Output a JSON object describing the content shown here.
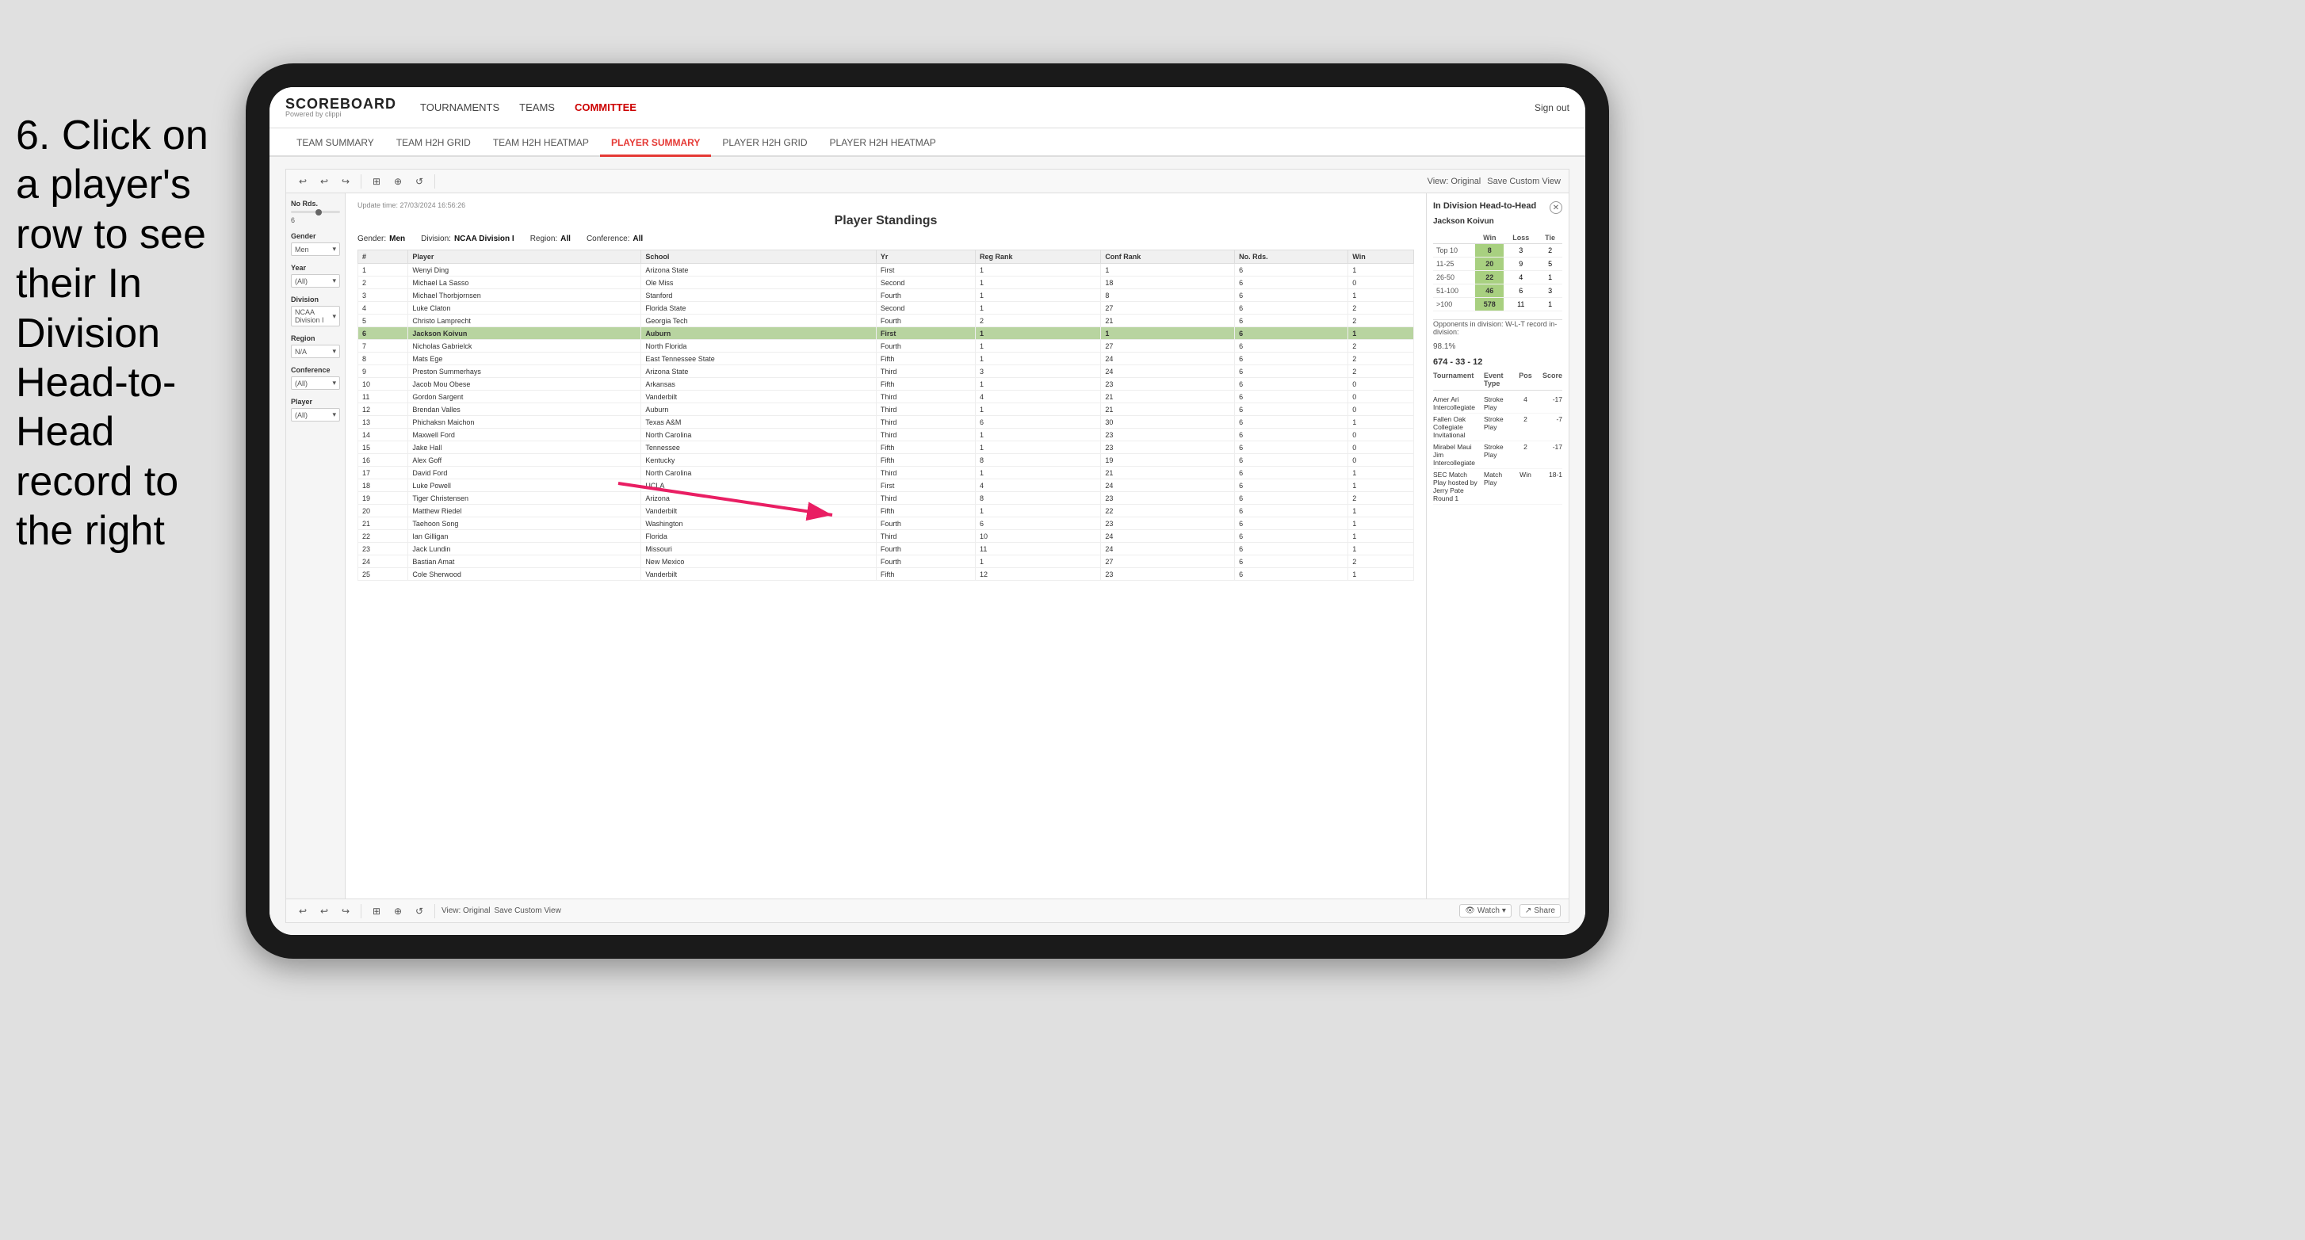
{
  "instruction": {
    "text": "6. Click on a player's row to see their In Division Head-to-Head record to the right"
  },
  "nav": {
    "logo": "SCOREBOARD",
    "powered": "Powered by clippi",
    "items": [
      "TOURNAMENTS",
      "TEAMS",
      "COMMITTEE"
    ],
    "sign_out": "Sign out"
  },
  "sub_nav": {
    "items": [
      "TEAM SUMMARY",
      "TEAM H2H GRID",
      "TEAM H2H HEATMAP",
      "PLAYER SUMMARY",
      "PLAYER H2H GRID",
      "PLAYER H2H HEATMAP"
    ],
    "active": "PLAYER SUMMARY"
  },
  "report": {
    "update_time_label": "Update time:",
    "update_time_value": "27/03/2024 16:56:26",
    "title": "Player Standings",
    "filters": {
      "gender_label": "Gender:",
      "gender_value": "Men",
      "division_label": "Division:",
      "division_value": "NCAA Division I",
      "region_label": "Region:",
      "region_value": "All",
      "conference_label": "Conference:",
      "conference_value": "All"
    }
  },
  "left_filters": {
    "no_rds": {
      "label": "No Rds.",
      "value": "6"
    },
    "gender": {
      "label": "Gender",
      "value": "Men"
    },
    "year": {
      "label": "Year",
      "value": "(All)"
    },
    "division": {
      "label": "Division",
      "value": "NCAA Division I"
    },
    "region": {
      "label": "Region",
      "value": "N/A"
    },
    "conference": {
      "label": "Conference",
      "value": "(All)"
    },
    "player": {
      "label": "Player",
      "value": "(All)"
    }
  },
  "table": {
    "headers": [
      "#",
      "Player",
      "School",
      "Yr",
      "Reg Rank",
      "Conf Rank",
      "No. Rds.",
      "Win"
    ],
    "rows": [
      {
        "rank": "1",
        "player": "Wenyi Ding",
        "school": "Arizona State",
        "yr": "First",
        "reg_rank": "1",
        "conf_rank": "1",
        "no_rds": "6",
        "win": "1",
        "highlighted": false
      },
      {
        "rank": "2",
        "player": "Michael La Sasso",
        "school": "Ole Miss",
        "yr": "Second",
        "reg_rank": "1",
        "conf_rank": "18",
        "no_rds": "6",
        "win": "0",
        "highlighted": false
      },
      {
        "rank": "3",
        "player": "Michael Thorbjornsen",
        "school": "Stanford",
        "yr": "Fourth",
        "reg_rank": "1",
        "conf_rank": "8",
        "no_rds": "6",
        "win": "1",
        "highlighted": false
      },
      {
        "rank": "4",
        "player": "Luke Claton",
        "school": "Florida State",
        "yr": "Second",
        "reg_rank": "1",
        "conf_rank": "27",
        "no_rds": "6",
        "win": "2",
        "highlighted": false
      },
      {
        "rank": "5",
        "player": "Christo Lamprecht",
        "school": "Georgia Tech",
        "yr": "Fourth",
        "reg_rank": "2",
        "conf_rank": "21",
        "no_rds": "6",
        "win": "2",
        "highlighted": false
      },
      {
        "rank": "6",
        "player": "Jackson Koivun",
        "school": "Auburn",
        "yr": "First",
        "reg_rank": "1",
        "conf_rank": "1",
        "no_rds": "6",
        "win": "1",
        "highlighted": true
      },
      {
        "rank": "7",
        "player": "Nicholas Gabrielck",
        "school": "North Florida",
        "yr": "Fourth",
        "reg_rank": "1",
        "conf_rank": "27",
        "no_rds": "6",
        "win": "2",
        "highlighted": false
      },
      {
        "rank": "8",
        "player": "Mats Ege",
        "school": "East Tennessee State",
        "yr": "Fifth",
        "reg_rank": "1",
        "conf_rank": "24",
        "no_rds": "6",
        "win": "2",
        "highlighted": false
      },
      {
        "rank": "9",
        "player": "Preston Summerhays",
        "school": "Arizona State",
        "yr": "Third",
        "reg_rank": "3",
        "conf_rank": "24",
        "no_rds": "6",
        "win": "2",
        "highlighted": false
      },
      {
        "rank": "10",
        "player": "Jacob Mou Obese",
        "school": "Arkansas",
        "yr": "Fifth",
        "reg_rank": "1",
        "conf_rank": "23",
        "no_rds": "6",
        "win": "0",
        "highlighted": false
      },
      {
        "rank": "11",
        "player": "Gordon Sargent",
        "school": "Vanderbilt",
        "yr": "Third",
        "reg_rank": "4",
        "conf_rank": "21",
        "no_rds": "6",
        "win": "0",
        "highlighted": false
      },
      {
        "rank": "12",
        "player": "Brendan Valles",
        "school": "Auburn",
        "yr": "Third",
        "reg_rank": "1",
        "conf_rank": "21",
        "no_rds": "6",
        "win": "0",
        "highlighted": false
      },
      {
        "rank": "13",
        "player": "Phichaksn Maichon",
        "school": "Texas A&M",
        "yr": "Third",
        "reg_rank": "6",
        "conf_rank": "30",
        "no_rds": "6",
        "win": "1",
        "highlighted": false
      },
      {
        "rank": "14",
        "player": "Maxwell Ford",
        "school": "North Carolina",
        "yr": "Third",
        "reg_rank": "1",
        "conf_rank": "23",
        "no_rds": "6",
        "win": "0",
        "highlighted": false
      },
      {
        "rank": "15",
        "player": "Jake Hall",
        "school": "Tennessee",
        "yr": "Fifth",
        "reg_rank": "1",
        "conf_rank": "23",
        "no_rds": "6",
        "win": "0",
        "highlighted": false
      },
      {
        "rank": "16",
        "player": "Alex Goff",
        "school": "Kentucky",
        "yr": "Fifth",
        "reg_rank": "8",
        "conf_rank": "19",
        "no_rds": "6",
        "win": "0",
        "highlighted": false
      },
      {
        "rank": "17",
        "player": "David Ford",
        "school": "North Carolina",
        "yr": "Third",
        "reg_rank": "1",
        "conf_rank": "21",
        "no_rds": "6",
        "win": "1",
        "highlighted": false
      },
      {
        "rank": "18",
        "player": "Luke Powell",
        "school": "UCLA",
        "yr": "First",
        "reg_rank": "4",
        "conf_rank": "24",
        "no_rds": "6",
        "win": "1",
        "highlighted": false
      },
      {
        "rank": "19",
        "player": "Tiger Christensen",
        "school": "Arizona",
        "yr": "Third",
        "reg_rank": "8",
        "conf_rank": "23",
        "no_rds": "6",
        "win": "2",
        "highlighted": false
      },
      {
        "rank": "20",
        "player": "Matthew Riedel",
        "school": "Vanderbilt",
        "yr": "Fifth",
        "reg_rank": "1",
        "conf_rank": "22",
        "no_rds": "6",
        "win": "1",
        "highlighted": false
      },
      {
        "rank": "21",
        "player": "Taehoon Song",
        "school": "Washington",
        "yr": "Fourth",
        "reg_rank": "6",
        "conf_rank": "23",
        "no_rds": "6",
        "win": "1",
        "highlighted": false
      },
      {
        "rank": "22",
        "player": "Ian Gilligan",
        "school": "Florida",
        "yr": "Third",
        "reg_rank": "10",
        "conf_rank": "24",
        "no_rds": "6",
        "win": "1",
        "highlighted": false
      },
      {
        "rank": "23",
        "player": "Jack Lundin",
        "school": "Missouri",
        "yr": "Fourth",
        "reg_rank": "11",
        "conf_rank": "24",
        "no_rds": "6",
        "win": "1",
        "highlighted": false
      },
      {
        "rank": "24",
        "player": "Bastian Amat",
        "school": "New Mexico",
        "yr": "Fourth",
        "reg_rank": "1",
        "conf_rank": "27",
        "no_rds": "6",
        "win": "2",
        "highlighted": false
      },
      {
        "rank": "25",
        "player": "Cole Sherwood",
        "school": "Vanderbilt",
        "yr": "Fifth",
        "reg_rank": "12",
        "conf_rank": "23",
        "no_rds": "6",
        "win": "1",
        "highlighted": false
      }
    ]
  },
  "h2h": {
    "title": "In Division Head-to-Head",
    "player_name": "Jackson Koivun",
    "table_headers": [
      "",
      "Win",
      "Loss",
      "Tie"
    ],
    "rows": [
      {
        "range": "Top 10",
        "win": "8",
        "loss": "3",
        "tie": "2"
      },
      {
        "range": "11-25",
        "win": "20",
        "loss": "9",
        "tie": "5"
      },
      {
        "range": "26-50",
        "win": "22",
        "loss": "4",
        "tie": "1"
      },
      {
        "range": "51-100",
        "win": "46",
        "loss": "6",
        "tie": "3"
      },
      {
        "range": ">100",
        "win": "578",
        "loss": "11",
        "tie": "1"
      }
    ],
    "opponents_label": "Opponents in division:",
    "opponents_value": "98.1%",
    "record_label": "W-L-T record in-division:",
    "record_value": "674 - 33 - 12",
    "tournament_headers": [
      "Tournament",
      "Event Type",
      "Pos",
      "Score"
    ],
    "tournaments": [
      {
        "name": "Amer Ari Intercollegiate",
        "event_type": "Stroke Play",
        "pos": "4",
        "score": "-17"
      },
      {
        "name": "Fallen Oak Collegiate Invitational",
        "event_type": "Stroke Play",
        "pos": "2",
        "score": "-7"
      },
      {
        "name": "Mirabel Maui Jim Intercollegiate",
        "event_type": "Stroke Play",
        "pos": "2",
        "score": "-17"
      },
      {
        "name": "SEC Match Play hosted by Jerry Pate Round 1",
        "event_type": "Match Play",
        "pos": "Win",
        "score": "18-1"
      }
    ]
  },
  "bottom_toolbar": {
    "view_original": "View: Original",
    "save_custom": "Save Custom View",
    "watch": "Watch",
    "share": "Share"
  }
}
